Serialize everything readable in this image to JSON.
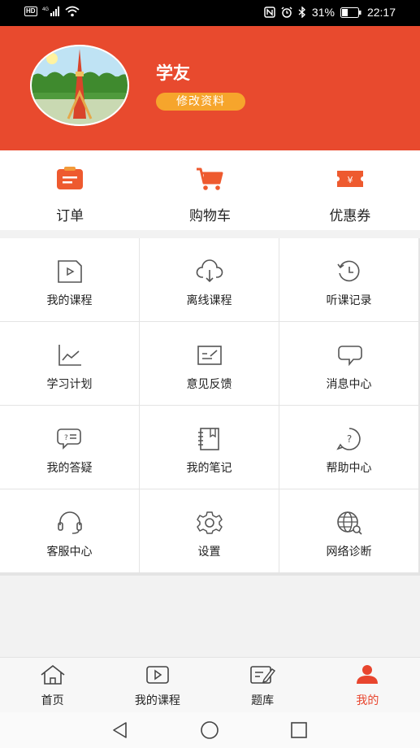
{
  "status_bar": {
    "network": "4G",
    "battery": "31%",
    "time": "22:17"
  },
  "profile": {
    "name": "学友",
    "edit_label": "修改资料"
  },
  "quick_actions": [
    {
      "label": "订单",
      "icon": "order-icon"
    },
    {
      "label": "购物车",
      "icon": "cart-icon"
    },
    {
      "label": "优惠券",
      "icon": "coupon-icon"
    }
  ],
  "menu": [
    {
      "label": "我的课程",
      "icon": "course-video-icon"
    },
    {
      "label": "离线课程",
      "icon": "cloud-download-icon"
    },
    {
      "label": "听课记录",
      "icon": "history-clock-icon"
    },
    {
      "label": "学习计划",
      "icon": "chart-line-icon"
    },
    {
      "label": "意见反馈",
      "icon": "feedback-icon"
    },
    {
      "label": "消息中心",
      "icon": "message-icon"
    },
    {
      "label": "我的答疑",
      "icon": "qa-chat-icon"
    },
    {
      "label": "我的笔记",
      "icon": "notebook-icon"
    },
    {
      "label": "帮助中心",
      "icon": "help-icon"
    },
    {
      "label": "客服中心",
      "icon": "headset-icon"
    },
    {
      "label": "设置",
      "icon": "settings-gear-icon"
    },
    {
      "label": "网络诊断",
      "icon": "network-globe-icon"
    }
  ],
  "tabs": [
    {
      "label": "首页",
      "icon": "home-icon"
    },
    {
      "label": "我的课程",
      "icon": "video-icon"
    },
    {
      "label": "题库",
      "icon": "question-bank-icon"
    },
    {
      "label": "我的",
      "icon": "user-icon",
      "active": true
    }
  ],
  "colors": {
    "brand": "#e84a2e",
    "accent": "#f6a52c",
    "active_tab": "#e8452e"
  }
}
